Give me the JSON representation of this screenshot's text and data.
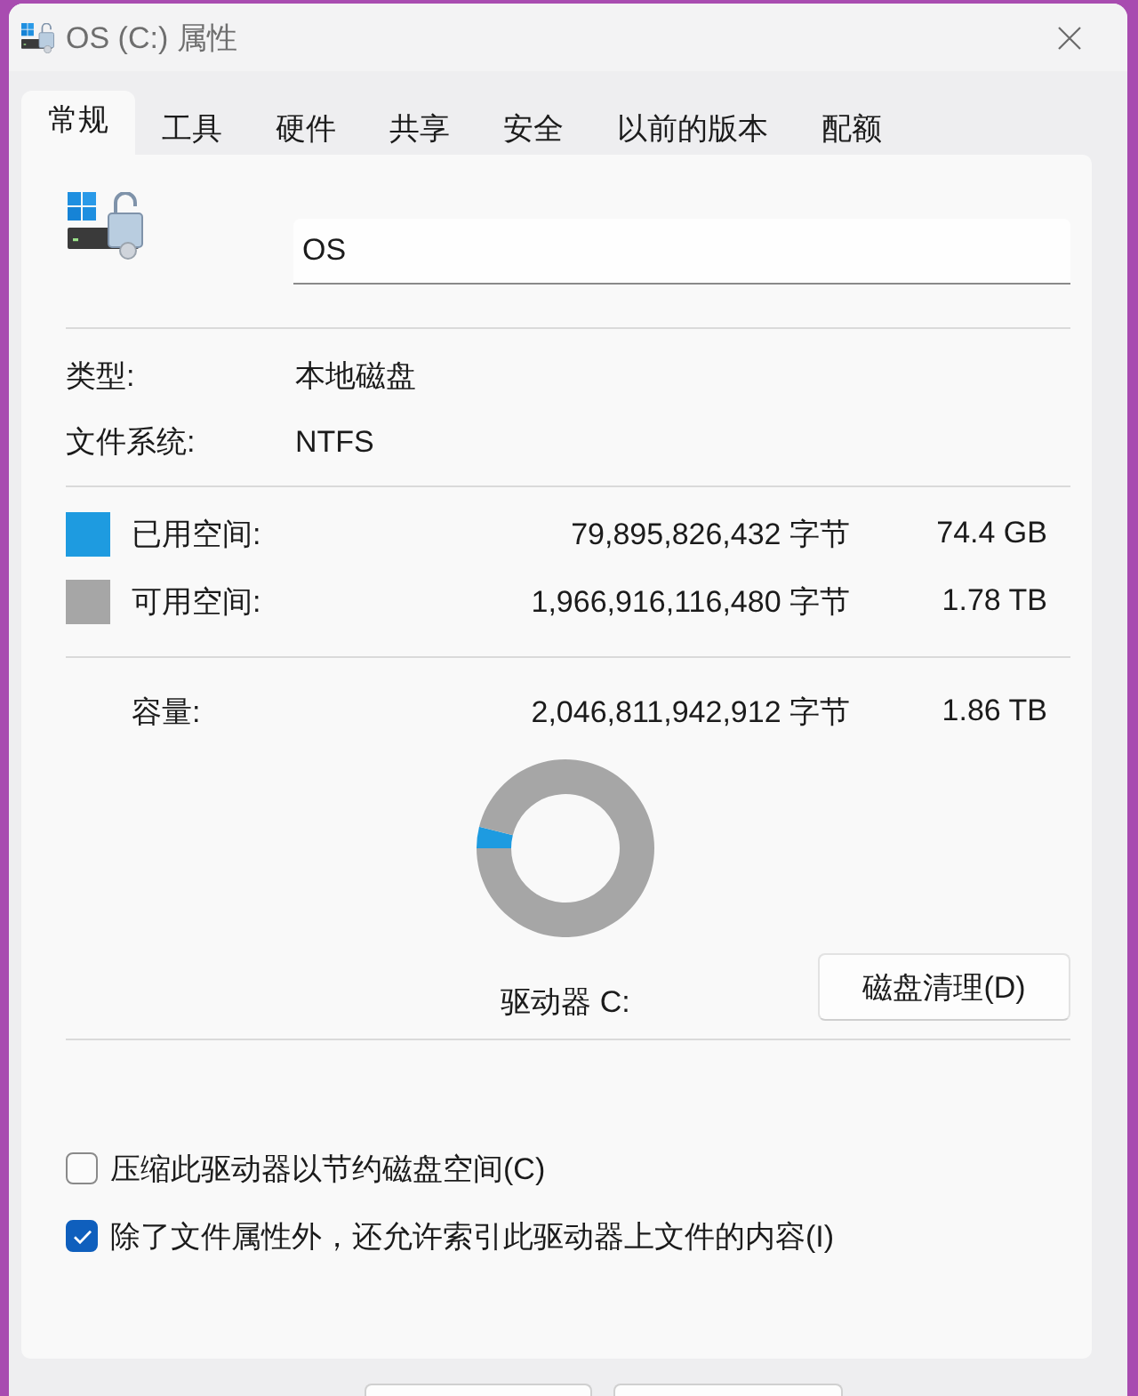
{
  "window": {
    "title": "OS (C:) 属性"
  },
  "tabs": [
    {
      "label": "常规",
      "selected": true
    },
    {
      "label": "工具",
      "selected": false
    },
    {
      "label": "硬件",
      "selected": false
    },
    {
      "label": "共享",
      "selected": false
    },
    {
      "label": "安全",
      "selected": false
    },
    {
      "label": "以前的版本",
      "selected": false
    },
    {
      "label": "配额",
      "selected": false
    }
  ],
  "drive": {
    "name": "OS"
  },
  "info": [
    {
      "label": "类型:",
      "value": "本地磁盘"
    },
    {
      "label": "文件系统:",
      "value": "NTFS"
    }
  ],
  "space": [
    {
      "label": "已用空间:",
      "bytes": "79,895,826,432 字节",
      "size": "74.4 GB",
      "color": "#1e9be0"
    },
    {
      "label": "可用空间:",
      "bytes": "1,966,916,116,480 字节",
      "size": "1.78 TB",
      "color": "#a6a6a6"
    }
  ],
  "capacity": {
    "label": "容量:",
    "bytes": "2,046,811,942,912 字节",
    "size": "1.86 TB"
  },
  "usage_chart": {
    "chart_data": {
      "type": "donut",
      "values": [
        3.9,
        96.1
      ]
    },
    "drive_label": "驱动器 C:"
  },
  "cleanup_button": {
    "label": "磁盘清理(D)"
  },
  "options": [
    {
      "label": "压缩此驱动器以节约磁盘空间(C)",
      "checked": false
    },
    {
      "label": "除了文件属性外，还允许索引此驱动器上文件的内容(I)",
      "checked": true
    }
  ]
}
